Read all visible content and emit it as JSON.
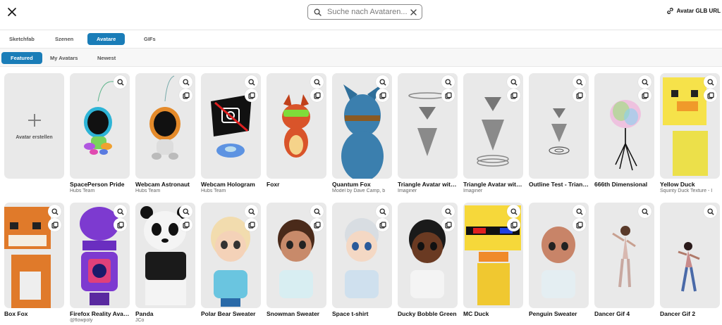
{
  "header": {
    "search_placeholder": "Suche nach Avataren...",
    "url_button_label": "Avatar GLB URL"
  },
  "source_tabs": [
    {
      "label": "Sketchfab",
      "active": false
    },
    {
      "label": "Szenen",
      "active": false
    },
    {
      "label": "Avatare",
      "active": true
    },
    {
      "label": "GIFs",
      "active": false
    }
  ],
  "filter_tabs": [
    {
      "label": "Featured",
      "active": true
    },
    {
      "label": "My Avatars",
      "active": false
    },
    {
      "label": "Newest",
      "active": false
    }
  ],
  "create_card": {
    "label": "Avatar erstellen"
  },
  "avatars": [
    {
      "title": "SpacePerson Pride",
      "subtitle": "Hubs Team",
      "icon": "astronaut-icon"
    },
    {
      "title": "Webcam Astronaut",
      "subtitle": "Hubs Team",
      "icon": "astronaut-icon"
    },
    {
      "title": "Webcam Hologram",
      "subtitle": "Hubs Team",
      "icon": "hologram-icon"
    },
    {
      "title": "Foxr",
      "subtitle": "",
      "icon": "fox-icon"
    },
    {
      "title": "Quantum Fox",
      "subtitle": "Model by Dave Camp, b",
      "icon": "fox-icon"
    },
    {
      "title": "Triangle Avatar with Halo",
      "subtitle": "Imaginer",
      "icon": "triangle-icon"
    },
    {
      "title": "Triangle Avatar with Base",
      "subtitle": "Imaginer",
      "icon": "triangle-icon"
    },
    {
      "title": "Outline Test - Triangle",
      "subtitle": "",
      "icon": "triangle-icon"
    },
    {
      "title": "666th Dimensional",
      "subtitle": "",
      "icon": "abstract-icon"
    },
    {
      "title": "Yellow Duck",
      "subtitle": "Squinty Duck Texture - I",
      "icon": "duck-icon"
    },
    {
      "title": "Box Fox",
      "subtitle": "",
      "icon": "fox-icon"
    },
    {
      "title": "Firefox Reality Avatar",
      "subtitle": "@flowpoly",
      "icon": "robot-icon"
    },
    {
      "title": "Panda",
      "subtitle": "JCo",
      "icon": "panda-icon"
    },
    {
      "title": "Polar Bear Sweater",
      "subtitle": "",
      "icon": "person-icon"
    },
    {
      "title": "Snowman Sweater",
      "subtitle": "",
      "icon": "person-icon"
    },
    {
      "title": "Space t-shirt",
      "subtitle": "",
      "icon": "person-icon"
    },
    {
      "title": "Ducky Bobble Green",
      "subtitle": "",
      "icon": "person-icon"
    },
    {
      "title": "MC Duck",
      "subtitle": "",
      "icon": "duck-icon"
    },
    {
      "title": "Penguin Sweater",
      "subtitle": "",
      "icon": "person-icon"
    },
    {
      "title": "Dancer Gif 4",
      "subtitle": "",
      "icon": "dancer-icon"
    },
    {
      "title": "Dancer Gif 2",
      "subtitle": "",
      "icon": "dancer-icon"
    }
  ],
  "colors": {
    "accent": "#1a7db8",
    "card_bg": "#e9e9e9"
  }
}
